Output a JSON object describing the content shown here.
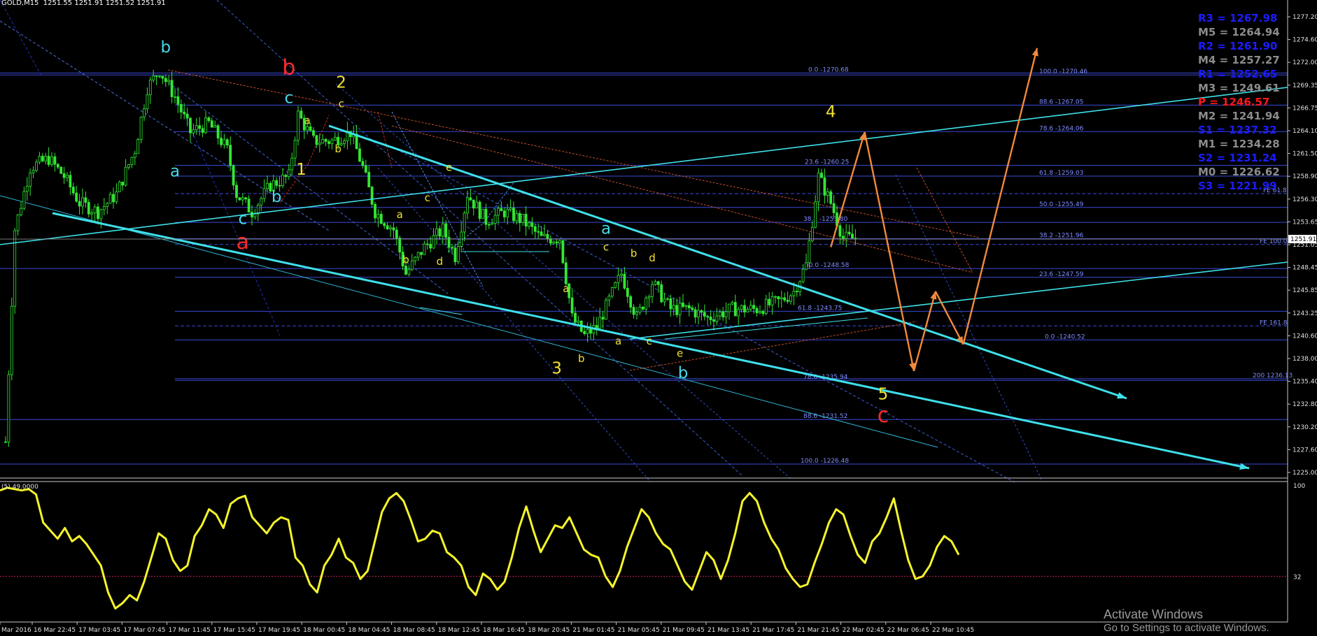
{
  "window": {
    "symbol_label": "GOLD,M15",
    "ohlc_label": "1251.55 1251.91 1251.52 1251.91"
  },
  "colors": {
    "background": "#000000",
    "grid": "#303030",
    "candles": "#32e832",
    "fib_lines": "#3a4bd6",
    "fib_text": "#7f8cff",
    "channel": "#3ee0ea",
    "forecast": "#f08a3c",
    "oscillator": "#f5f52a",
    "label_yellow": "#f2e22e",
    "label_cyan": "#46d8e8",
    "label_red": "#ff2a2a",
    "pivot_resistance": "#1c1cff",
    "pivot_mid": "#8c8c8c",
    "pivot_pivot": "#ff1a1a"
  },
  "chart_data": [
    {
      "type": "candlestick",
      "title": "GOLD,M15",
      "ylim": [
        1224.9,
        1278.3
      ],
      "y_ticks": [
        "1277.20",
        "1274.60",
        "1272.00",
        "1269.35",
        "1266.75",
        "1264.10",
        "1261.50",
        "1258.90",
        "1256.30",
        "1253.65",
        "1251.05",
        "1248.45",
        "1245.85",
        "1243.25",
        "1240.60",
        "1238.00",
        "1235.40",
        "1232.80",
        "1230.20",
        "1227.60",
        "1225.00"
      ],
      "current_price": "1251.91",
      "x_tick_labels": [
        "Mar 2016",
        "16 Mar 22:45",
        "17 Mar 03:45",
        "17 Mar 07:45",
        "17 Mar 11:45",
        "17 Mar 15:45",
        "17 Mar 19:45",
        "18 Mar 00:45",
        "18 Mar 04:45",
        "18 Mar 08:45",
        "18 Mar 12:45",
        "18 Mar 16:45",
        "18 Mar 20:45",
        "21 Mar 01:45",
        "21 Mar 05:45",
        "21 Mar 09:45",
        "21 Mar 13:45",
        "21 Mar 17:45",
        "21 Mar 21:45",
        "22 Mar 02:45",
        "22 Mar 06:45",
        "22 Mar 10:45"
      ],
      "price_path": [
        {
          "bar": 0,
          "price": 1229
        },
        {
          "bar": 3,
          "price": 1253
        },
        {
          "bar": 8,
          "price": 1260
        },
        {
          "bar": 14,
          "price": 1261
        },
        {
          "bar": 19,
          "price": 1259
        },
        {
          "bar": 24,
          "price": 1256
        },
        {
          "bar": 30,
          "price": 1255
        },
        {
          "bar": 36,
          "price": 1257
        },
        {
          "bar": 42,
          "price": 1262
        },
        {
          "bar": 46,
          "price": 1269
        },
        {
          "bar": 50,
          "price": 1271
        },
        {
          "bar": 55,
          "price": 1268
        },
        {
          "bar": 60,
          "price": 1264
        },
        {
          "bar": 66,
          "price": 1265
        },
        {
          "bar": 72,
          "price": 1262
        },
        {
          "bar": 75,
          "price": 1257
        },
        {
          "bar": 80,
          "price": 1255
        },
        {
          "bar": 86,
          "price": 1258
        },
        {
          "bar": 92,
          "price": 1259
        },
        {
          "bar": 95,
          "price": 1266
        },
        {
          "bar": 100,
          "price": 1263
        },
        {
          "bar": 106,
          "price": 1263
        },
        {
          "bar": 112,
          "price": 1264
        },
        {
          "bar": 116,
          "price": 1260
        },
        {
          "bar": 120,
          "price": 1255
        },
        {
          "bar": 126,
          "price": 1253
        },
        {
          "bar": 130,
          "price": 1248
        },
        {
          "bar": 136,
          "price": 1251
        },
        {
          "bar": 142,
          "price": 1253
        },
        {
          "bar": 146,
          "price": 1250
        },
        {
          "bar": 150,
          "price": 1257
        },
        {
          "bar": 156,
          "price": 1254
        },
        {
          "bar": 162,
          "price": 1255
        },
        {
          "bar": 168,
          "price": 1254
        },
        {
          "bar": 174,
          "price": 1252
        },
        {
          "bar": 180,
          "price": 1252
        },
        {
          "bar": 184,
          "price": 1243
        },
        {
          "bar": 188,
          "price": 1241
        },
        {
          "bar": 192,
          "price": 1242
        },
        {
          "bar": 196,
          "price": 1245
        },
        {
          "bar": 200,
          "price": 1248
        },
        {
          "bar": 205,
          "price": 1243
        },
        {
          "bar": 210,
          "price": 1247
        },
        {
          "bar": 216,
          "price": 1244
        },
        {
          "bar": 222,
          "price": 1244
        },
        {
          "bar": 228,
          "price": 1243
        },
        {
          "bar": 236,
          "price": 1244
        },
        {
          "bar": 244,
          "price": 1244
        },
        {
          "bar": 252,
          "price": 1245
        },
        {
          "bar": 256,
          "price": 1246
        },
        {
          "bar": 260,
          "price": 1249
        },
        {
          "bar": 264,
          "price": 1259
        },
        {
          "bar": 268,
          "price": 1256
        },
        {
          "bar": 272,
          "price": 1252
        },
        {
          "bar": 276,
          "price": 1252
        }
      ],
      "fib_levels": [
        {
          "label": "0.0 -1270.68",
          "price": 1270.68
        },
        {
          "label": "100.0 -1270.46",
          "price": 1270.46
        },
        {
          "label": "88.6 -1267.05",
          "price": 1267.05
        },
        {
          "label": "78.6 -1264.06",
          "price": 1264.06
        },
        {
          "label": "23.6 -1260.25",
          "price": 1260.25
        },
        {
          "label": "61.8 -1259.03",
          "price": 1259.03
        },
        {
          "label": "FE 61.8",
          "price": 1257.05
        },
        {
          "label": "50.0 -1255.49",
          "price": 1255.49
        },
        {
          "label": "38.2 -1253.80",
          "price": 1253.8
        },
        {
          "label": "38.2 -1251.96",
          "price": 1251.96
        },
        {
          "label": "FE 100.0",
          "price": 1251.3
        },
        {
          "label": "50.0 -1248.58",
          "price": 1248.58
        },
        {
          "label": "23.6 -1247.59",
          "price": 1247.59
        },
        {
          "label": "61.8 -1243.75",
          "price": 1243.75
        },
        {
          "label": "FE 161.8",
          "price": 1242.1
        },
        {
          "label": "0.0 -1240.52",
          "price": 1240.52
        },
        {
          "label": "200 1236.13",
          "price": 1236.13
        },
        {
          "label": "78.6 -1235.94",
          "price": 1235.94
        },
        {
          "label": "88.6 -1231.52",
          "price": 1231.52
        },
        {
          "label": "100.0 -1226.48",
          "price": 1226.48
        }
      ],
      "wave_labels": [
        {
          "text": "b",
          "color": "cyan",
          "bar": 52,
          "price": 1273.0,
          "size": "large"
        },
        {
          "text": "b",
          "color": "red",
          "bar": 92,
          "price": 1270.5,
          "size": "xl"
        },
        {
          "text": "2",
          "color": "yellow",
          "bar": 109,
          "price": 1269.0,
          "size": "large"
        },
        {
          "text": "c",
          "color": "cyan",
          "bar": 92,
          "price": 1267.3,
          "size": "large"
        },
        {
          "text": "c",
          "color": "yellow",
          "bar": 109,
          "price": 1266.8,
          "size": "small"
        },
        {
          "text": "a",
          "color": "yellow",
          "bar": 98,
          "price": 1264.9,
          "size": "small"
        },
        {
          "text": "b",
          "color": "yellow",
          "bar": 108,
          "price": 1261.7,
          "size": "small"
        },
        {
          "text": "1",
          "color": "yellow",
          "bar": 96,
          "price": 1259.2,
          "size": "large"
        },
        {
          "text": "a",
          "color": "cyan",
          "bar": 55,
          "price": 1259.0,
          "size": "large"
        },
        {
          "text": "b",
          "color": "cyan",
          "bar": 88,
          "price": 1256.1,
          "size": "large"
        },
        {
          "text": "c",
          "color": "cyan",
          "bar": 77,
          "price": 1253.6,
          "size": "large"
        },
        {
          "text": "a",
          "color": "red",
          "bar": 77,
          "price": 1250.8,
          "size": "xl"
        },
        {
          "text": "e",
          "color": "yellow",
          "bar": 144,
          "price": 1259.6,
          "size": "small"
        },
        {
          "text": "c",
          "color": "yellow",
          "bar": 137,
          "price": 1256.2,
          "size": "small"
        },
        {
          "text": "a",
          "color": "yellow",
          "bar": 128,
          "price": 1254.3,
          "size": "small"
        },
        {
          "text": "b",
          "color": "yellow",
          "bar": 130,
          "price": 1249.2,
          "size": "small"
        },
        {
          "text": "d",
          "color": "yellow",
          "bar": 141,
          "price": 1249.0,
          "size": "small"
        },
        {
          "text": "a",
          "color": "cyan",
          "bar": 195,
          "price": 1252.5,
          "size": "large"
        },
        {
          "text": "c",
          "color": "yellow",
          "bar": 195,
          "price": 1250.6,
          "size": "small"
        },
        {
          "text": "b",
          "color": "yellow",
          "bar": 204,
          "price": 1249.9,
          "size": "small"
        },
        {
          "text": "d",
          "color": "yellow",
          "bar": 210,
          "price": 1249.4,
          "size": "small"
        },
        {
          "text": "a",
          "color": "yellow",
          "bar": 182,
          "price": 1245.9,
          "size": "small"
        },
        {
          "text": "a",
          "color": "yellow",
          "bar": 199,
          "price": 1240.0,
          "size": "small"
        },
        {
          "text": "c",
          "color": "yellow",
          "bar": 209,
          "price": 1240.0,
          "size": "small"
        },
        {
          "text": "b",
          "color": "yellow",
          "bar": 187,
          "price": 1238.0,
          "size": "small"
        },
        {
          "text": "e",
          "color": "yellow",
          "bar": 219,
          "price": 1238.6,
          "size": "small"
        },
        {
          "text": "3",
          "color": "yellow",
          "bar": 179,
          "price": 1236.7,
          "size": "large"
        },
        {
          "text": "b",
          "color": "cyan",
          "bar": 220,
          "price": 1236.2,
          "size": "large"
        },
        {
          "text": "4",
          "color": "yellow",
          "bar": 268,
          "price": 1265.7,
          "size": "large"
        },
        {
          "text": "5",
          "color": "yellow",
          "bar": 285,
          "price": 1233.8,
          "size": "large"
        },
        {
          "text": "c",
          "color": "red",
          "bar": 285,
          "price": 1231.2,
          "size": "xl"
        }
      ],
      "forecast_path": [
        {
          "bar": 268,
          "price": 1251.0
        },
        {
          "bar": 279,
          "price": 1264.0
        },
        {
          "bar": 295,
          "price": 1237.0
        },
        {
          "bar": 302,
          "price": 1246.0
        },
        {
          "bar": 311,
          "price": 1240.0
        },
        {
          "bar": 335,
          "price": 1273.5
        }
      ]
    },
    {
      "type": "line",
      "title": "oscillator",
      "ylim": [
        0,
        100
      ],
      "y_ticks": [
        "100",
        "32"
      ],
      "header_text": "(5) 49.0000",
      "level_line": 32,
      "values": [
        96,
        98,
        97,
        96,
        97,
        93,
        72,
        66,
        60,
        68,
        58,
        62,
        56,
        48,
        40,
        20,
        8,
        12,
        18,
        14,
        28,
        46,
        64,
        60,
        44,
        36,
        40,
        62,
        70,
        82,
        78,
        68,
        86,
        90,
        92,
        76,
        70,
        64,
        72,
        76,
        74,
        46,
        40,
        26,
        20,
        40,
        48,
        60,
        46,
        42,
        30,
        36,
        58,
        80,
        90,
        94,
        88,
        74,
        58,
        60,
        66,
        64,
        50,
        46,
        40,
        24,
        18,
        34,
        30,
        22,
        28,
        46,
        68,
        84,
        66,
        50,
        60,
        70,
        68,
        76,
        64,
        52,
        48,
        46,
        32,
        24,
        36,
        54,
        68,
        82,
        76,
        64,
        56,
        52,
        40,
        28,
        22,
        36,
        50,
        44,
        30,
        44,
        64,
        88,
        94,
        88,
        72,
        60,
        52,
        38,
        30,
        24,
        26,
        42,
        56,
        72,
        82,
        78,
        62,
        48,
        42,
        58,
        64,
        76,
        90,
        66,
        44,
        30,
        32,
        40,
        54,
        62,
        58,
        48
      ]
    }
  ],
  "pivot_levels": [
    {
      "label": "R3 = 1267.98",
      "kind": "resistance"
    },
    {
      "label": "M5 = 1264.94",
      "kind": "mid"
    },
    {
      "label": "R2 = 1261.90",
      "kind": "resistance"
    },
    {
      "label": "M4 = 1257.27",
      "kind": "mid"
    },
    {
      "label": "R1 = 1252.65",
      "kind": "resistance"
    },
    {
      "label": "M3 = 1249.61",
      "kind": "mid"
    },
    {
      "label": "P  = 1246.57",
      "kind": "pivot"
    },
    {
      "label": "M2 = 1241.94",
      "kind": "mid"
    },
    {
      "label": "S1 = 1237.32",
      "kind": "resistance"
    },
    {
      "label": "M1 = 1234.28",
      "kind": "mid"
    },
    {
      "label": "S2 = 1231.24",
      "kind": "resistance"
    },
    {
      "label": "M0 = 1226.62",
      "kind": "mid"
    },
    {
      "label": "S3 = 1221.99",
      "kind": "resistance"
    }
  ],
  "watermark": {
    "title": "Activate Windows",
    "subtitle": "Go to Settings to activate Windows."
  }
}
